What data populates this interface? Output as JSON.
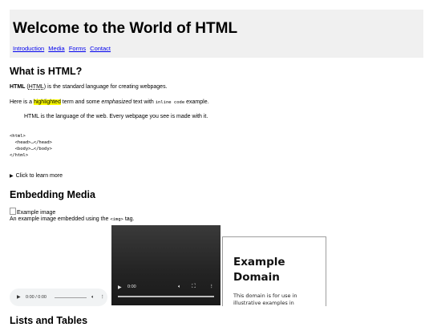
{
  "header": {
    "title": "Welcome to the World of HTML",
    "nav": [
      "Introduction",
      "Media",
      "Forms",
      "Contact"
    ]
  },
  "intro": {
    "heading": "What is HTML?",
    "p1_strong": "HTML",
    "p1_abbr": "HTML",
    "p1_rest": " is the standard language for creating webpages.",
    "p2_a": "Here is a ",
    "p2_mark": "highlighted",
    "p2_b": " term and some ",
    "p2_em": "emphasized",
    "p2_c": " text with ",
    "p2_code": "inline code",
    "p2_d": " example.",
    "quote": "HTML is the language of the web. Every webpage you see is made with it.",
    "pre": "<html>\n  <head>…</head>\n  <body>…</body>\n</html>",
    "details_summary": "Click to learn more"
  },
  "media": {
    "heading": "Embedding Media",
    "img_alt": "Example image",
    "caption_a": "An example image embedded using the ",
    "caption_code": "<img>",
    "caption_b": " tag.",
    "audio_time": "0:00 / 0:00",
    "video_time": "0:00",
    "iframe_title": "Example Domain",
    "iframe_text": "This domain is for use in illustrative examples in"
  },
  "lists": {
    "heading": "Lists and Tables"
  }
}
